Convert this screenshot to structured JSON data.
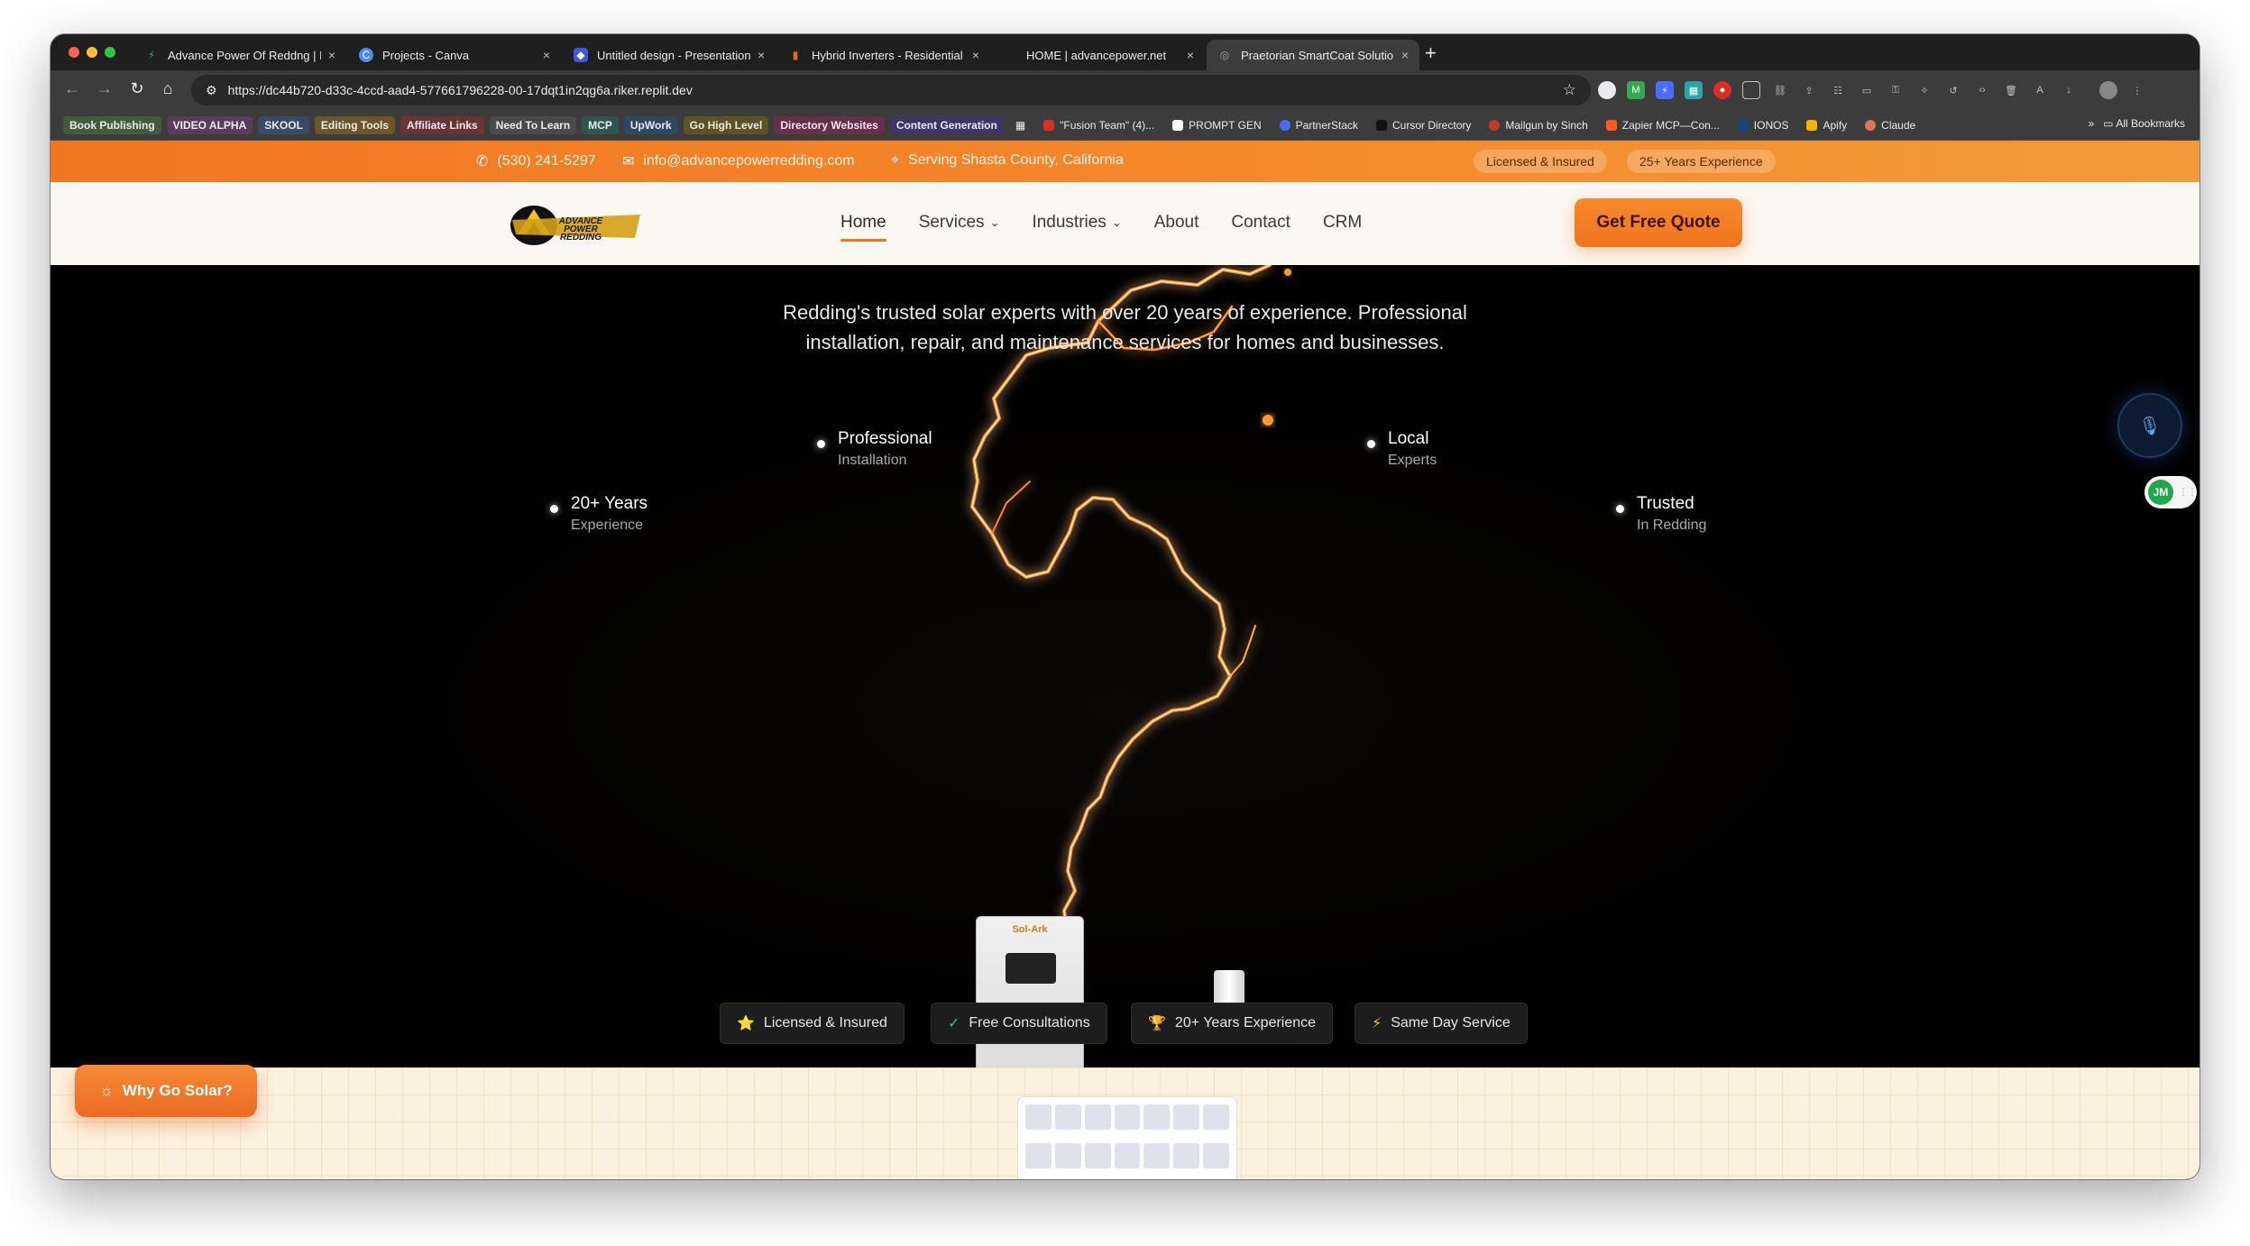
{
  "browser": {
    "tabs": [
      {
        "title": "Advance Power Of Reddng | F",
        "icon": "bolt-icon",
        "icon_color": "#34a853"
      },
      {
        "title": "Projects - Canva",
        "icon": "canva-icon",
        "icon_color": "#4a8cf7"
      },
      {
        "title": "Untitled design - Presentation",
        "icon": "shield-icon",
        "icon_color": "#3b5bdb"
      },
      {
        "title": "Hybrid Inverters - Residential",
        "icon": "doc-icon",
        "icon_color": "#e8710a"
      },
      {
        "title": "HOME | advancepower.net",
        "icon": "",
        "icon_color": ""
      },
      {
        "title": "Praetorian SmartCoat Solutio",
        "icon": "globe-icon",
        "icon_color": "#9aa0a6"
      }
    ],
    "url": "https://dc44b720-d33c-4ccd-aad4-577661796228-00-17dqt1in2qg6a.riker.replit.dev",
    "bookmarks": [
      "Book Publishing",
      "VIDEO ALPHA",
      "SKOOL",
      "Editing Tools",
      "Affiliate Links",
      "Need To Learn",
      "MCP",
      "UpWork",
      "Go High Level",
      "Directory Websites",
      "Content Generation"
    ],
    "bookmark_colors": [
      "#d6e6c8",
      "#e6c8e6",
      "#c8d8f0",
      "#f0dcb4",
      "#f2c2c2",
      "#e0e0e0",
      "#c8e6e0",
      "#c8dcf0",
      "#f0e0b4",
      "#f0c8d8",
      "#d8d0f0"
    ],
    "bookmarks_plain": [
      "\"Fusion Team\" (4)...",
      "PROMPT GEN",
      "PartnerStack",
      "Cursor Directory",
      "Mailgun by Sinch",
      "Zapier MCP—Con...",
      "IONOS",
      "Apify",
      "Claude"
    ],
    "all_bookmarks": "All Bookmarks"
  },
  "site": {
    "topbar": {
      "phone": "(530) 241-5297",
      "email": "info@advancepowerredding.com",
      "location": "Serving Shasta County, California",
      "pill_1": "Licensed & Insured",
      "pill_2": "25+ Years Experience"
    },
    "logo_text": "ADVANCE POWER REDDING",
    "nav": [
      "Home",
      "Services",
      "Industries",
      "About",
      "Contact",
      "CRM"
    ],
    "cta": "Get Free Quote",
    "hero": {
      "subtitle_line_1": "Redding's trusted solar experts with over 20 years of experience. Professional",
      "subtitle_line_2": "installation, repair, and maintenance services for homes and businesses.",
      "features": [
        {
          "title": "Professional",
          "subtitle": "Installation"
        },
        {
          "title": "Local",
          "subtitle": "Experts"
        },
        {
          "title": "20+ Years",
          "subtitle": "Experience"
        },
        {
          "title": "Trusted",
          "subtitle": "In Redding"
        }
      ],
      "badges": [
        {
          "icon": "⭐",
          "label": "Licensed & Insured"
        },
        {
          "icon": "✓",
          "label": "Free Consultations"
        },
        {
          "icon": "🏆",
          "label": "20+ Years Experience"
        },
        {
          "icon": "⚡",
          "label": "Same Day Service"
        }
      ],
      "inverter_brand": "Sol-Ark"
    },
    "why_button": "Why Go Solar?",
    "ext_badge": "JM",
    "accent_color": "#f07722"
  }
}
